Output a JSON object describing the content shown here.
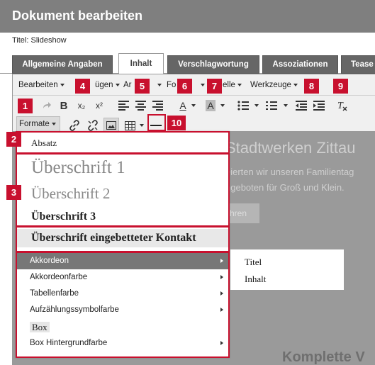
{
  "header": {
    "title": "Dokument bearbeiten"
  },
  "subtitle": "Titel: Slideshow",
  "tabs": [
    {
      "label": "Allgemeine Angaben",
      "active": false
    },
    {
      "label": "Inhalt",
      "active": true
    },
    {
      "label": "Verschlagwortung",
      "active": false
    },
    {
      "label": "Assoziationen",
      "active": false
    },
    {
      "label": "Tease",
      "active": false
    }
  ],
  "menubar": {
    "items": [
      "Bearbeiten",
      "ügen",
      "Ar",
      "Fo",
      "elle",
      "Werkzeuge"
    ]
  },
  "toolbar": {
    "formats_label": "Formate",
    "bold_label": "B",
    "subscript_label": "x₂",
    "superscript_label": "x²",
    "font_color_label": "A",
    "bg_color_label": "A"
  },
  "badges": [
    "1",
    "2",
    "3",
    "4",
    "5",
    "6",
    "7",
    "8",
    "9",
    "10"
  ],
  "background": {
    "heading": "Stadtwerken Zittau",
    "line1": "eierten wir unseren Familientag",
    "line2": "ngeboten für Groß und Klein.",
    "button": "hren",
    "heading2": "Komplette V"
  },
  "formats_dropdown": {
    "absatz": "Absatz",
    "h1": "Überschrift 1",
    "h2": "Überschrift 2",
    "h3": "Überschrift 3",
    "h_contact": "Überschrift eingebetteter Kontakt",
    "items": [
      {
        "label": "Akkordeon",
        "submenu": true,
        "highlighted": true
      },
      {
        "label": "Akkordeonfarbe",
        "submenu": true,
        "highlighted": false
      },
      {
        "label": "Tabellenfarbe",
        "submenu": true,
        "highlighted": false
      },
      {
        "label": "Aufzählungssymbolfarbe",
        "submenu": true,
        "highlighted": false
      },
      {
        "label": "Box",
        "submenu": false,
        "highlighted": false
      },
      {
        "label": "Box Hintergrundfarbe",
        "submenu": true,
        "highlighted": false
      }
    ]
  },
  "accordion_submenu": {
    "items": [
      "Titel",
      "Inhalt"
    ]
  },
  "colors": {
    "accent_red": "#c8102e",
    "header_gray": "#7f7f7f",
    "highlight_gray": "#777777"
  }
}
